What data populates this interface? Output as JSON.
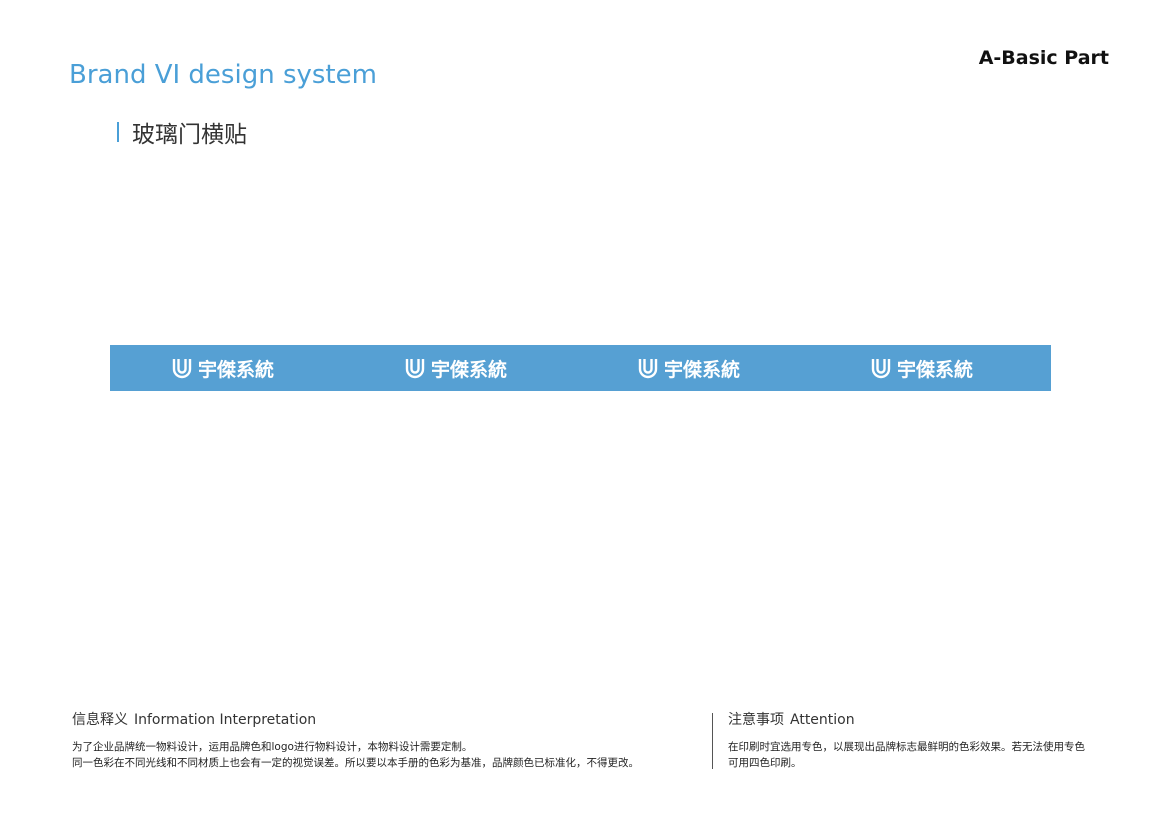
{
  "header": {
    "brand_title": "Brand VI design system",
    "part_label": "A-Basic Part"
  },
  "section": {
    "title": "玻璃门横贴"
  },
  "banner": {
    "background_color": "#56a0d3",
    "logo_icon": "u-logo-mark-icon",
    "logos": [
      {
        "text": "宇傑系統"
      },
      {
        "text": "宇傑系統"
      },
      {
        "text": "宇傑系統"
      },
      {
        "text": "宇傑系統"
      }
    ]
  },
  "footer": {
    "info": {
      "heading_cn": "信息释义",
      "heading_en": "Information Interpretation",
      "lines": [
        "为了企业品牌统一物料设计，运用品牌色和logo进行物料设计，本物料设计需要定制。",
        "同一色彩在不同光线和不同材质上也会有一定的视觉误差。所以要以本手册的色彩为基准，品牌颜色已标准化，不得更改。"
      ]
    },
    "attention": {
      "heading_cn": "注意事项",
      "heading_en": "Attention",
      "lines": [
        "在印刷时宜选用专色，以展现出品牌标志最鲜明的色彩效果。若无法使用专色",
        "可用四色印刷。"
      ]
    }
  },
  "colors": {
    "accent": "#4a9fd7",
    "banner": "#56a0d3"
  }
}
